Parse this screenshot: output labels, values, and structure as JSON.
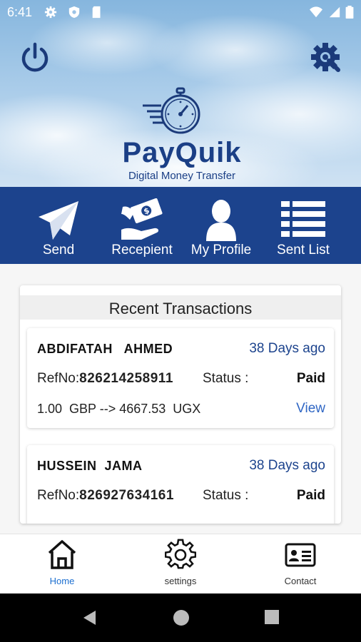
{
  "status_bar": {
    "time": "6:41"
  },
  "brand": {
    "name": "PayQuik",
    "tagline": "Digital Money Transfer"
  },
  "header_icons": [
    "power-icon",
    "settings-gear-icon"
  ],
  "nav": {
    "send": "Send",
    "recipient": "Recepient",
    "profile": "My Profile",
    "sent_list": "Sent List"
  },
  "recent": {
    "title": "Recent Transactions",
    "transactions": [
      {
        "name": "ABDIFATAH   AHMED",
        "ago": "38 Days ago",
        "ref_label": "RefNo:",
        "ref_no": "826214258911",
        "status_label": "Status :",
        "status": "Paid",
        "amount": "1.00  GBP --> 4667.53  UGX",
        "view": "View"
      },
      {
        "name": "HUSSEIN  JAMA",
        "ago": "38 Days ago",
        "ref_label": "RefNo:",
        "ref_no": "826927634161",
        "status_label": "Status :",
        "status": "Paid",
        "amount": "",
        "view": ""
      }
    ]
  },
  "bottom_nav": {
    "home": "Home",
    "settings": "settings",
    "contact": "Contact"
  },
  "colors": {
    "brand_blue": "#1c438d",
    "link_blue": "#2f66c4",
    "active_tab": "#1c6fd0"
  }
}
